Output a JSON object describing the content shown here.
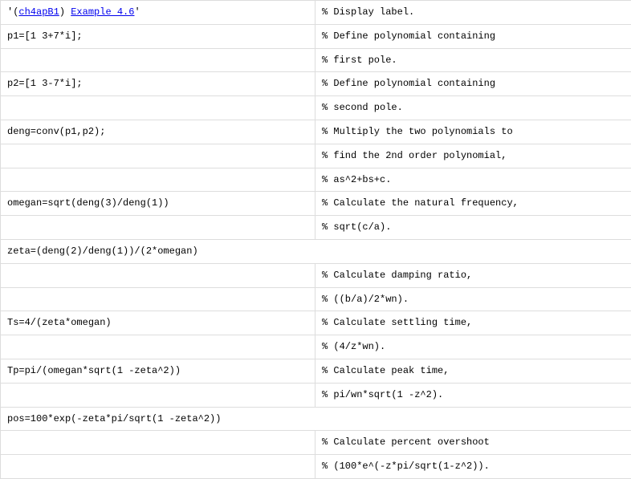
{
  "row1": {
    "link1": "ch4apB1",
    "link2": "Example 4.6",
    "comment": "% Display label."
  },
  "rows": [
    {
      "code": "p1=[1 3+7*i];",
      "comment": "% Define polynomial containing"
    },
    {
      "code": "",
      "comment": "% first pole."
    },
    {
      "code": "p2=[1 3-7*i];",
      "comment": "% Define polynomial containing"
    },
    {
      "code": "",
      "comment": "% second pole."
    },
    {
      "code": "deng=conv(p1,p2);",
      "comment": "% Multiply the two polynomials to"
    },
    {
      "code": "",
      "comment": "% find the 2nd order polynomial,"
    },
    {
      "code": "",
      "comment": "% as^2+bs+c."
    },
    {
      "code": "omegan=sqrt(deng(3)/deng(1))",
      "comment": "% Calculate the natural frequency,"
    },
    {
      "code": "",
      "comment": "% sqrt(c/a)."
    }
  ],
  "span1": "zeta=(deng(2)/deng(1))/(2*omegan)",
  "rows2": [
    {
      "code": "",
      "comment": "% Calculate damping ratio,"
    },
    {
      "code": "",
      "comment": "% ((b/a)/2*wn)."
    },
    {
      "code": "Ts=4/(zeta*omegan)",
      "comment": "% Calculate settling time,"
    },
    {
      "code": "",
      "comment": "% (4/z*wn)."
    },
    {
      "code": "Tp=pi/(omegan*sqrt(1 -zeta^2))",
      "comment": "% Calculate peak time,"
    },
    {
      "code": "",
      "comment": "% pi/wn*sqrt(1 -z^2)."
    }
  ],
  "span2": "pos=100*exp(-zeta*pi/sqrt(1 -zeta^2))",
  "rows3": [
    {
      "code": "",
      "comment": "% Calculate percent overshoot"
    },
    {
      "code": "",
      "comment": "% (100*e^(-z*pi/sqrt(1-z^2))."
    }
  ]
}
